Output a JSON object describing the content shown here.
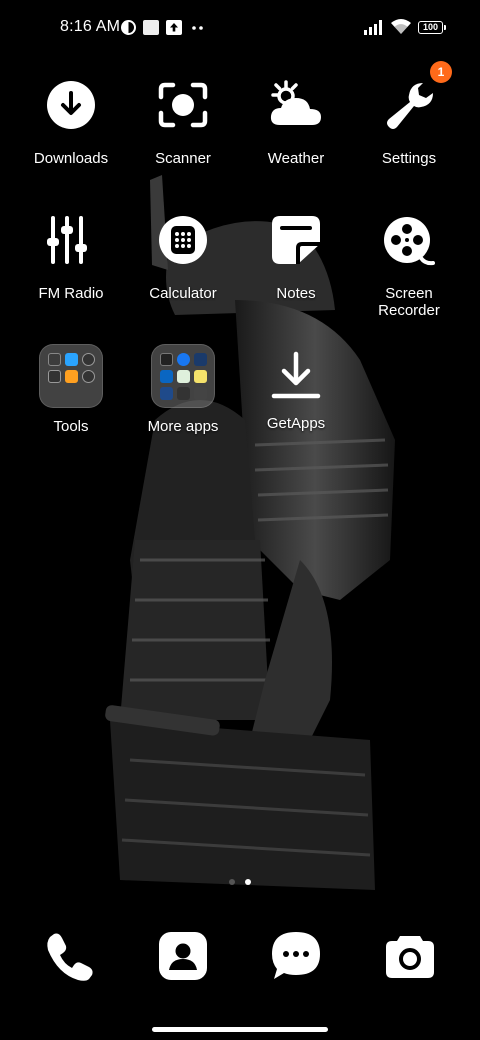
{
  "status_bar": {
    "time": "8:16 AM",
    "battery": "100",
    "icons": [
      "vpn-icon",
      "square-notification-icon",
      "upload-icon",
      "more-dots-icon",
      "signal-icon",
      "wifi-icon",
      "battery-icon"
    ]
  },
  "apps": {
    "downloads": "Downloads",
    "scanner": "Scanner",
    "weather": "Weather",
    "settings": "Settings",
    "settings_badge": "1",
    "fm_radio": "FM Radio",
    "calculator": "Calculator",
    "notes": "Notes",
    "screen_recorder_line1": "Screen",
    "screen_recorder_line2": "Recorder",
    "tools": "Tools",
    "more_apps": "More apps",
    "getapps": "GetApps"
  },
  "page_indicator": {
    "pages": 2,
    "current": 2
  },
  "dock": [
    "phone-icon",
    "contacts-icon",
    "messages-icon",
    "camera-icon"
  ],
  "colors": {
    "badge": "#ff6a1a",
    "background": "#000000",
    "folder": "#6e6e6e"
  }
}
